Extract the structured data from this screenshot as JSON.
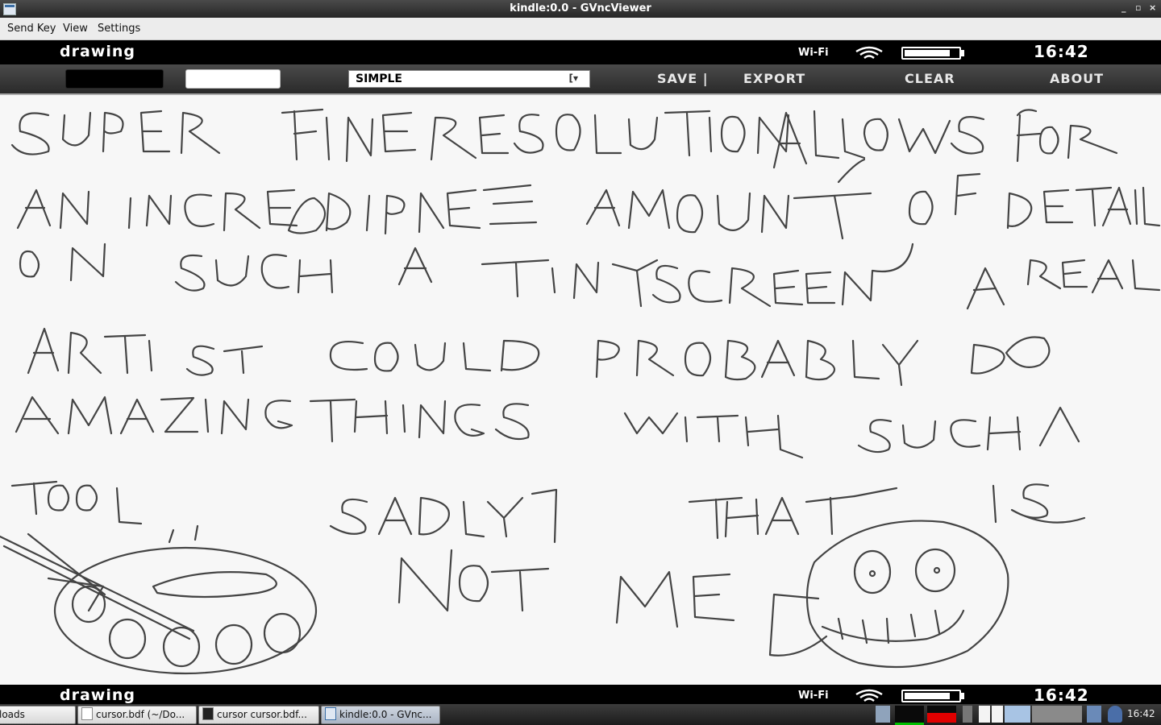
{
  "window": {
    "title": "kindle:0.0 - GVncViewer",
    "controls": [
      "_",
      "▫",
      "×"
    ]
  },
  "menubar": {
    "items": [
      "Send Key",
      "View",
      "Settings"
    ]
  },
  "kindle_status_top": {
    "app_name": "drawing",
    "wifi_label": "Wi-Fi",
    "time": "16:42",
    "battery_level": 0.9
  },
  "kindle_toolbar": {
    "brush_select_value": "SIMPLE",
    "brush_select_arrow": "[▾",
    "save_label": "SAVE |",
    "export_label": "EXPORT",
    "clear_label": "CLEAR",
    "about_label": "ABOUT"
  },
  "canvas": {
    "handwriting": [
      "SUPER FINE RESOLUTION ALLOWS FOR",
      "AN INCREDIBLE AMOUNT OF DETAIL",
      "ON SUCH A TINY SCREEN A REAL",
      "ARTIST COULD PROBABLY DO",
      "AMAZING THINGS WITH SUCH A",
      "TOOL, SADLY THAT IS",
      "NOT ME"
    ]
  },
  "kindle_status_bottom": {
    "app_name": "drawing",
    "wifi_label": "Wi-Fi",
    "time": "16:42"
  },
  "taskbar": {
    "tasks": [
      {
        "label": "loads"
      },
      {
        "label": "cursor.bdf (~/Do..."
      },
      {
        "label": "cursor  cursor.bdf..."
      },
      {
        "label": "kindle:0.0 - GVnc..."
      }
    ],
    "clock": "16:42",
    "colors": {
      "net_graph": "#00c000",
      "cpu_graph": "#e00000"
    }
  }
}
